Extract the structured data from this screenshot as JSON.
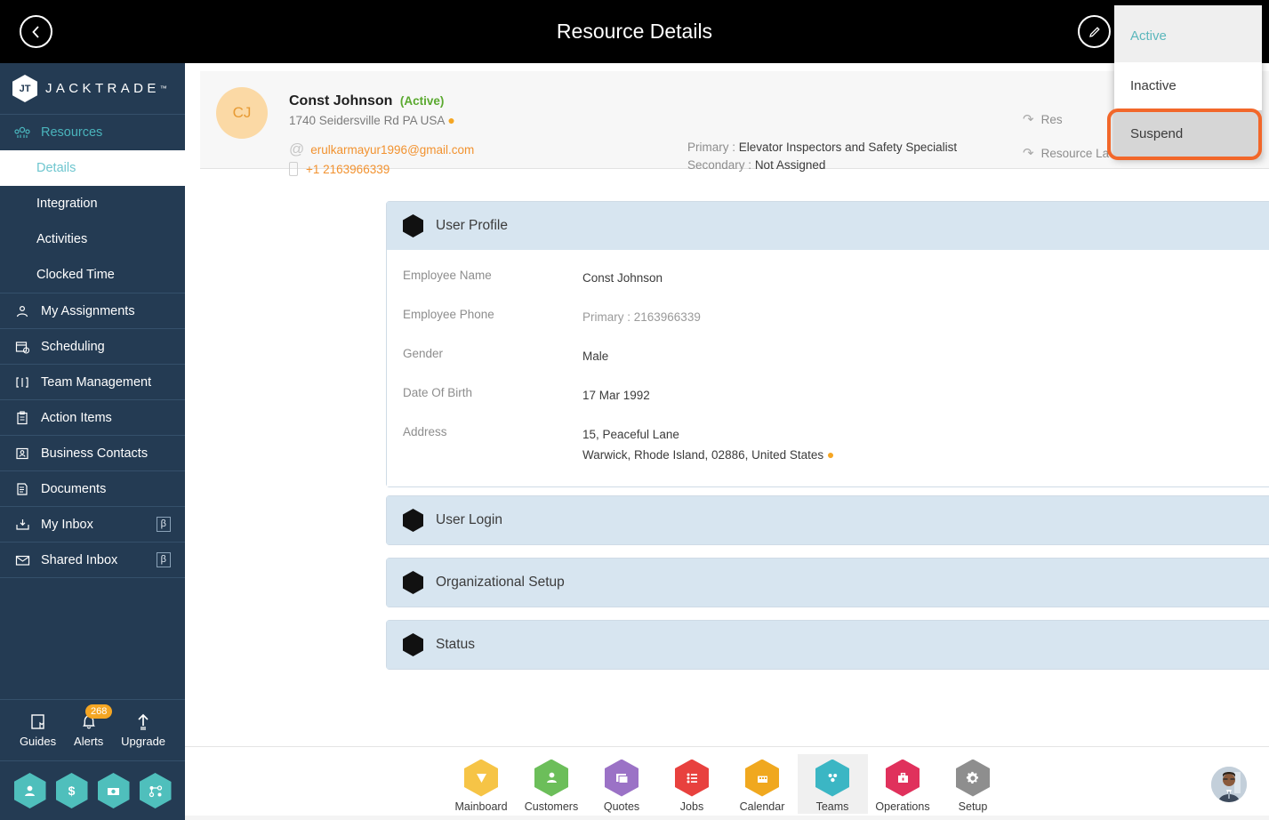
{
  "topbar": {
    "title": "Resource Details",
    "back_icon": "chevron-left-icon",
    "edit_icon": "pencil-icon"
  },
  "status_dropdown": {
    "items": [
      {
        "label": "Active",
        "state": "selected"
      },
      {
        "label": "Inactive",
        "state": "normal"
      },
      {
        "label": "Suspend",
        "state": "highlighted"
      }
    ],
    "highlight_color": "#f2672a",
    "selected_color": "#5bb7bc"
  },
  "sidebar": {
    "brand": {
      "name": "JACKTRADE",
      "tm": "™",
      "mark": "jacktrade-hex-logo"
    },
    "parent": {
      "label": "Resources",
      "icon": "resources-icon"
    },
    "sub_items": [
      {
        "label": "Details",
        "selected": true
      },
      {
        "label": "Integration",
        "selected": false
      },
      {
        "label": "Activities",
        "selected": false
      },
      {
        "label": "Clocked Time",
        "selected": false
      }
    ],
    "items": [
      {
        "label": "My Assignments",
        "icon": "assignments-icon",
        "badge": ""
      },
      {
        "label": "Scheduling",
        "icon": "calendar-clock-icon",
        "badge": ""
      },
      {
        "label": "Team Management",
        "icon": "team-icon",
        "badge": ""
      },
      {
        "label": "Action Items",
        "icon": "clipboard-icon",
        "badge": ""
      },
      {
        "label": "Business Contacts",
        "icon": "contact-card-icon",
        "badge": ""
      },
      {
        "label": "Documents",
        "icon": "document-icon",
        "badge": ""
      },
      {
        "label": "My Inbox",
        "icon": "inbox-down-icon",
        "badge": "β"
      },
      {
        "label": "Shared Inbox",
        "icon": "mail-icon",
        "badge": "β"
      }
    ],
    "utils": [
      {
        "label": "Guides",
        "icon": "book-icon",
        "badge": ""
      },
      {
        "label": "Alerts",
        "icon": "bell-icon",
        "badge": "268"
      },
      {
        "label": "Upgrade",
        "icon": "arrow-up-icon",
        "badge": ""
      }
    ],
    "quick_hexes": [
      {
        "icon": "person-icon"
      },
      {
        "icon": "dollar-icon"
      },
      {
        "icon": "money-transfer-icon"
      },
      {
        "icon": "workflow-icon"
      }
    ]
  },
  "profile": {
    "initials": "CJ",
    "name": "Const Johnson",
    "status": "(Active)",
    "address_line": "1740 Seidersville Rd PA USA",
    "email": "erulkarmayur1996@gmail.com",
    "phone": "+1 2163966339",
    "roles": {
      "primary_label": "Primary :",
      "primary_value": "Elevator Inspectors and Safety Specialist",
      "secondary_label": "Secondary :",
      "secondary_value": "Not Assigned"
    },
    "actions": [
      {
        "label": "Res",
        "icon": "loop-arrow-icon"
      },
      {
        "label": "Resource La",
        "icon": "loop-arrow-icon"
      }
    ]
  },
  "panels": [
    {
      "title": "User Profile",
      "expanded": true,
      "chevron": "chevron-up-icon",
      "fields": [
        {
          "label": "Employee Name",
          "value": "Const Johnson",
          "muted": false
        },
        {
          "label": "Employee Phone",
          "value": "Primary :  2163966339",
          "muted": true
        },
        {
          "label": "Gender",
          "value": "Male",
          "muted": false
        },
        {
          "label": "Date Of Birth",
          "value": "17 Mar 1992",
          "muted": false
        }
      ],
      "address": {
        "label": "Address",
        "line1": "15, Peaceful Lane",
        "line2": "Warwick, Rhode Island, 02886, United States"
      }
    },
    {
      "title": "User Login",
      "expanded": false,
      "chevron": "chevron-down-icon"
    },
    {
      "title": "Organizational Setup",
      "expanded": false,
      "chevron": "chevron-down-icon"
    },
    {
      "title": "Status",
      "expanded": false,
      "chevron": "chevron-down-icon"
    }
  ],
  "bottom_nav": {
    "items": [
      {
        "label": "Mainboard",
        "color": "#f6c446",
        "icon": "shield-icon",
        "active": false
      },
      {
        "label": "Customers",
        "color": "#6cbe5a",
        "icon": "person-icon",
        "active": false
      },
      {
        "label": "Quotes",
        "color": "#9b72c6",
        "icon": "quote-icon",
        "active": false
      },
      {
        "label": "Jobs",
        "color": "#e8413e",
        "icon": "list-icon",
        "active": false
      },
      {
        "label": "Calendar",
        "color": "#f0a81f",
        "icon": "calendar-icon",
        "active": false
      },
      {
        "label": "Teams",
        "color": "#3bb6c4",
        "icon": "teams-icon",
        "active": true
      },
      {
        "label": "Operations",
        "color": "#e0315c",
        "icon": "briefcase-icon",
        "active": false
      },
      {
        "label": "Setup",
        "color": "#8e8e8e",
        "icon": "gear-icon",
        "active": false
      }
    ],
    "avatar": "user-avatar-photo"
  }
}
